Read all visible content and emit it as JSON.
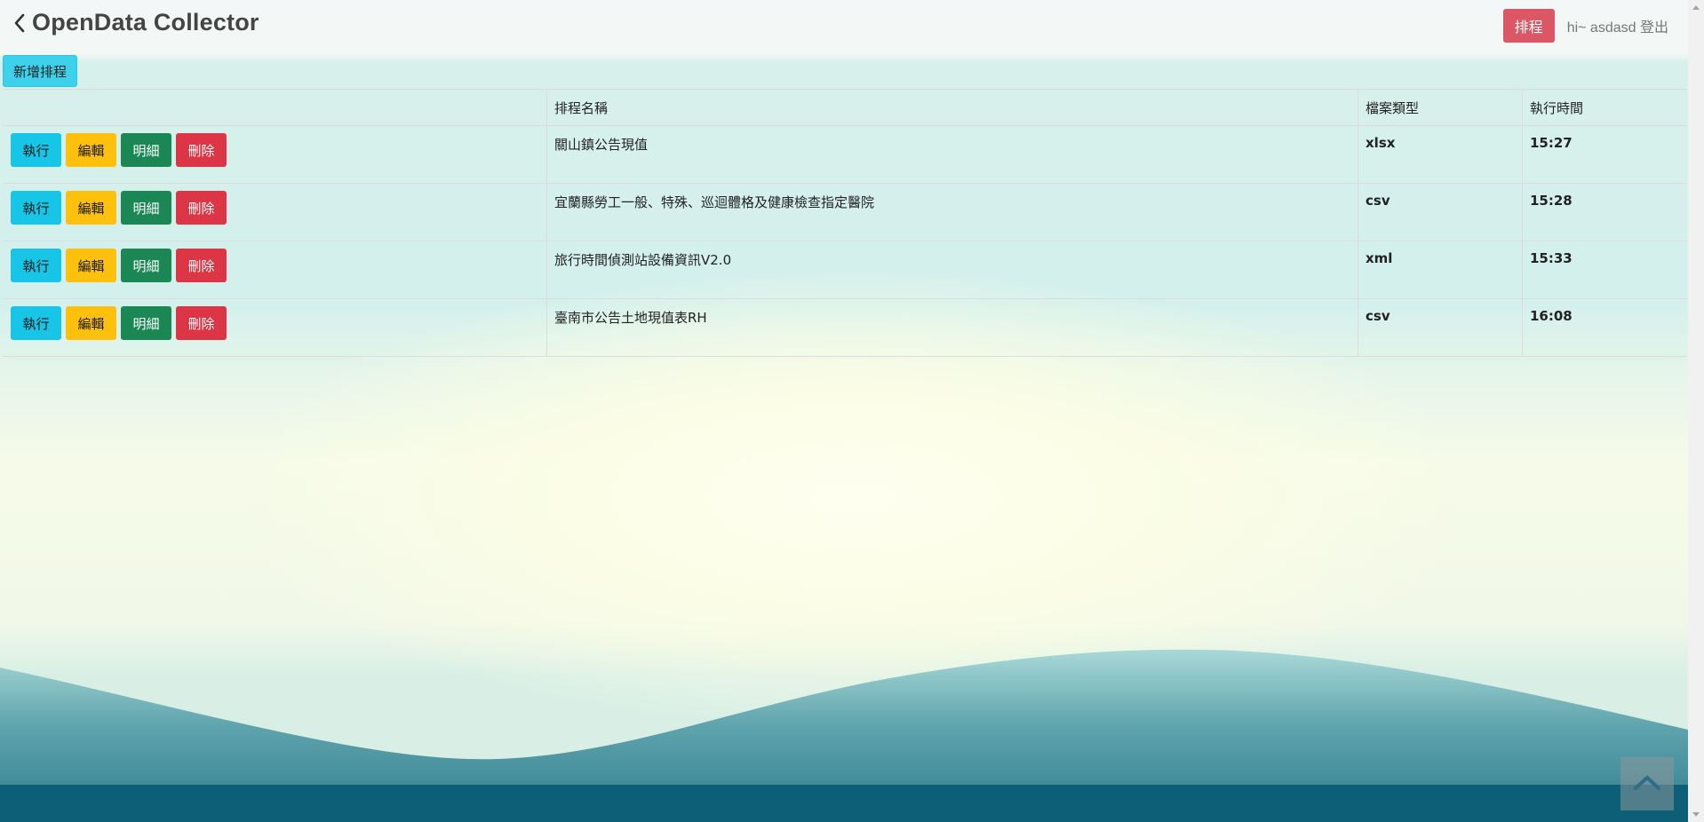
{
  "navbar": {
    "title": "OpenData Collector",
    "schedule_button": "排程",
    "greeting": "hi~ asdasd",
    "logout": "登出"
  },
  "toolbar": {
    "new_schedule_button": "新增排程"
  },
  "table": {
    "headers": {
      "actions": "",
      "name": "排程名稱",
      "file_type": "檔案類型",
      "run_time": "執行時間"
    },
    "action_labels": {
      "run": "執行",
      "edit": "編輯",
      "detail": "明細",
      "delete": "刪除"
    },
    "rows": [
      {
        "name": "關山鎮公告現值",
        "file_type": "xlsx",
        "run_time": "15:27"
      },
      {
        "name": "宜蘭縣勞工一般、特殊、巡迴體格及健康檢查指定醫院",
        "file_type": "csv",
        "run_time": "15:28"
      },
      {
        "name": "旅行時間偵測站設備資訊V2.0",
        "file_type": "xml",
        "run_time": "15:33"
      },
      {
        "name": "臺南市公告土地現值表RH",
        "file_type": "csv",
        "run_time": "16:08"
      }
    ]
  },
  "colors": {
    "schedule_button": "#db5766",
    "new_button": "#3ed1ec",
    "run_button": "#17c5e6",
    "edit_button": "#fdc00d",
    "detail_button": "#1a8754",
    "delete_button": "#dc3545",
    "wave_dark": "#0d5f78"
  },
  "icons": {
    "back": "chevron-left-icon",
    "scroll_top": "chevron-up-icon"
  }
}
